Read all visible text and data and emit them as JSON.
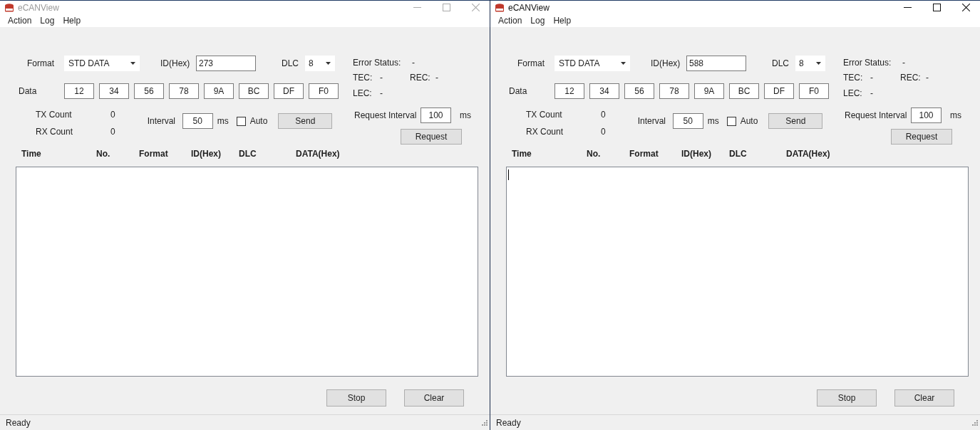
{
  "windows": [
    {
      "title": "eCANView",
      "active": false,
      "menu": [
        "Action",
        "Log",
        "Help"
      ],
      "format": {
        "label": "Format",
        "value": "STD DATA"
      },
      "id": {
        "label": "ID(Hex)",
        "value": "273"
      },
      "dlc": {
        "label": "DLC",
        "value": "8"
      },
      "data": {
        "label": "Data",
        "bytes": [
          "12",
          "34",
          "56",
          "78",
          "9A",
          "BC",
          "DF",
          "F0"
        ]
      },
      "error_status": {
        "label": "Error Status:",
        "value": "-"
      },
      "tec": {
        "label": "TEC:",
        "value": "-"
      },
      "rec": {
        "label": "REC:",
        "value": "-"
      },
      "lec": {
        "label": "LEC:",
        "value": "-"
      },
      "tx_count": {
        "label": "TX Count",
        "value": "0"
      },
      "rx_count": {
        "label": "RX Count",
        "value": "0"
      },
      "interval": {
        "label": "Interval",
        "value": "50",
        "unit": "ms"
      },
      "auto": {
        "label": "Auto",
        "checked": false
      },
      "send_button": "Send",
      "request_interval": {
        "label": "Request Interval",
        "value": "100",
        "unit": "ms"
      },
      "request_button": "Request",
      "columns": [
        "Time",
        "No.",
        "Format",
        "ID(Hex)",
        "DLC",
        "DATA(Hex)"
      ],
      "buttons": [
        "Stop",
        "Clear"
      ],
      "status": "Ready"
    },
    {
      "title": "eCANView",
      "active": true,
      "menu": [
        "Action",
        "Log",
        "Help"
      ],
      "format": {
        "label": "Format",
        "value": "STD DATA"
      },
      "id": {
        "label": "ID(Hex)",
        "value": "588"
      },
      "dlc": {
        "label": "DLC",
        "value": "8"
      },
      "data": {
        "label": "Data",
        "bytes": [
          "12",
          "34",
          "56",
          "78",
          "9A",
          "BC",
          "DF",
          "F0"
        ]
      },
      "error_status": {
        "label": "Error Status:",
        "value": "-"
      },
      "tec": {
        "label": "TEC:",
        "value": "-"
      },
      "rec": {
        "label": "REC:",
        "value": "-"
      },
      "lec": {
        "label": "LEC:",
        "value": "-"
      },
      "tx_count": {
        "label": "TX Count",
        "value": "0"
      },
      "rx_count": {
        "label": "RX Count",
        "value": "0"
      },
      "interval": {
        "label": "Interval",
        "value": "50",
        "unit": "ms"
      },
      "auto": {
        "label": "Auto",
        "checked": false
      },
      "send_button": "Send",
      "request_interval": {
        "label": "Request Interval",
        "value": "100",
        "unit": "ms"
      },
      "request_button": "Request",
      "columns": [
        "Time",
        "No.",
        "Format",
        "ID(Hex)",
        "DLC",
        "DATA(Hex)"
      ],
      "buttons": [
        "Stop",
        "Clear"
      ],
      "status": "Ready"
    }
  ]
}
